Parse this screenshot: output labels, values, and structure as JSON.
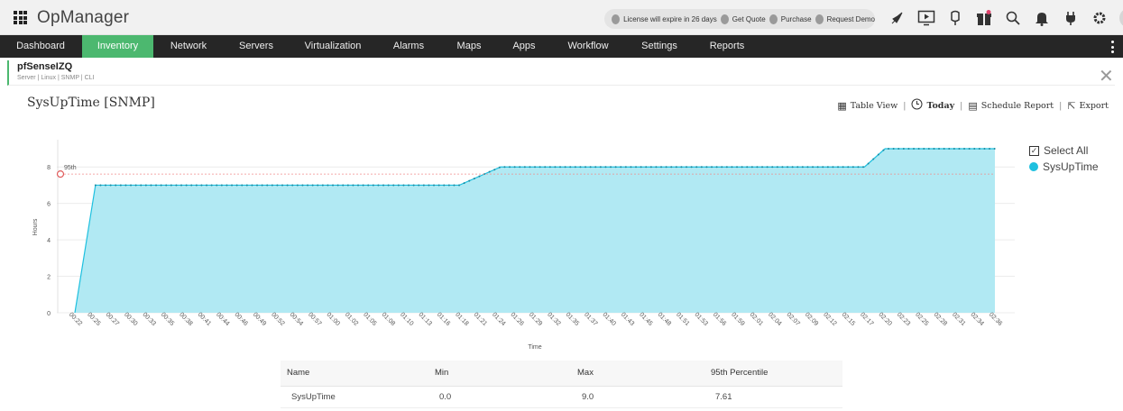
{
  "app": {
    "title": "OpManager"
  },
  "license": {
    "expiry_text": "License will expire in 26 days",
    "links": [
      {
        "label": "Get Quote",
        "icon": "quote-icon"
      },
      {
        "label": "Purchase",
        "icon": "cart-icon"
      },
      {
        "label": "Request Demo",
        "icon": "demo-icon"
      }
    ]
  },
  "toolbar_icons": [
    "rocket-icon",
    "play-screen-icon",
    "plugin-icon",
    "gift-icon",
    "search-icon",
    "bell-icon",
    "power-plug-icon",
    "gear-icon",
    "avatar-icon"
  ],
  "nav": {
    "items": [
      "Dashboard",
      "Inventory",
      "Network",
      "Servers",
      "Virtualization",
      "Alarms",
      "Maps",
      "Apps",
      "Workflow",
      "Settings",
      "Reports"
    ],
    "active": "Inventory"
  },
  "device": {
    "name": "pfSenseIZQ",
    "tags": "Server | Linux | SNMP | CLI"
  },
  "page": {
    "title": "SysUpTime [SNMP]"
  },
  "actions": {
    "table_view": "Table View",
    "period": "Today",
    "schedule_report": "Schedule Report",
    "export": "Export"
  },
  "legend": {
    "select_all": "Select All"
  },
  "colors": {
    "accent": "#4cb86f",
    "series": "#1ec0df",
    "area_fill": "#b1e9f3",
    "percentile_line": "#f08e8e"
  },
  "chart_data": {
    "type": "area",
    "xlabel": "Time",
    "ylabel": "Hours",
    "ylim": [
      0,
      9
    ],
    "yticks": [
      0,
      2,
      4,
      6,
      8
    ],
    "grid": true,
    "legend_position": "right",
    "x_labels": [
      "00:22",
      "00:25",
      "00:27",
      "00:30",
      "00:33",
      "00:35",
      "00:38",
      "00:41",
      "00:44",
      "00:46",
      "00:49",
      "00:52",
      "00:54",
      "00:57",
      "01:00",
      "01:02",
      "01:05",
      "01:08",
      "01:10",
      "01:13",
      "01:16",
      "01:18",
      "01:21",
      "01:24",
      "01:26",
      "01:29",
      "01:32",
      "01:35",
      "01:37",
      "01:40",
      "01:43",
      "01:45",
      "01:48",
      "01:51",
      "01:53",
      "01:56",
      "01:59",
      "02:01",
      "02:04",
      "02:07",
      "02:09",
      "02:12",
      "02:15",
      "02:17",
      "02:20",
      "02:23",
      "02:25",
      "02:28",
      "02:31",
      "02:34",
      "02:36"
    ],
    "series": [
      {
        "name": "SysUpTime",
        "points": [
          {
            "x": "00:22",
            "y": 0
          },
          {
            "x": "00:25",
            "y": 7
          },
          {
            "x": "01:18",
            "y": 7
          },
          {
            "x": "01:24",
            "y": 8
          },
          {
            "x": "02:17",
            "y": 8
          },
          {
            "x": "02:20",
            "y": 9
          },
          {
            "x": "02:36",
            "y": 9
          }
        ]
      }
    ],
    "percentile_label": "95th",
    "percentile_value": 7.61
  },
  "stats_table": {
    "headers": [
      "Name",
      "Min",
      "Max",
      "95th Percentile"
    ],
    "rows": [
      [
        "SysUpTime",
        "0.0",
        "9.0",
        "7.61"
      ]
    ]
  }
}
